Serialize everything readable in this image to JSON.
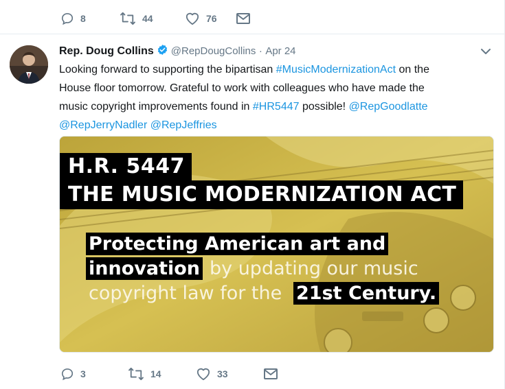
{
  "previous_tweet": {
    "reply_count": "8",
    "retweet_count": "44",
    "like_count": "76"
  },
  "tweet": {
    "author_name": "Rep. Doug Collins",
    "handle": "@RepDougCollins",
    "separator": "·",
    "timestamp": "Apr 24",
    "text": {
      "l1_a": "Looking forward to supporting the bipartisan ",
      "l1_link": "#MusicModernizationAct",
      "l1_b": " on the",
      "l2": "House floor tomorrow. Grateful to work with colleagues who have made the",
      "l3_a": "music copyright improvements found in ",
      "l3_link1": "#HR5447",
      "l3_b": " possible! ",
      "l3_link2": "@RepGoodlatte",
      "l4_link1": "@RepJerryNadler",
      "l4_link2": "@RepJeffries"
    },
    "image": {
      "title": "H.R. 5447",
      "subtitle": "THE MUSIC MODERNIZATION ACT",
      "body_l1": "Protecting American art and",
      "body_l2_bold": "innovation",
      "body_l2_rest": "by updating our music",
      "body_l3_rest": "copyright law for the",
      "body_l3_bold": "21st Century."
    },
    "reply_count": "3",
    "retweet_count": "14",
    "like_count": "33"
  },
  "colors": {
    "link": "#1b95e0",
    "muted": "#657786",
    "verified": "#1da1f2",
    "image_bg": "#c9b24a"
  },
  "icons": [
    "reply-icon",
    "retweet-icon",
    "like-icon",
    "message-icon",
    "verified-icon",
    "chevron-down-icon"
  ]
}
